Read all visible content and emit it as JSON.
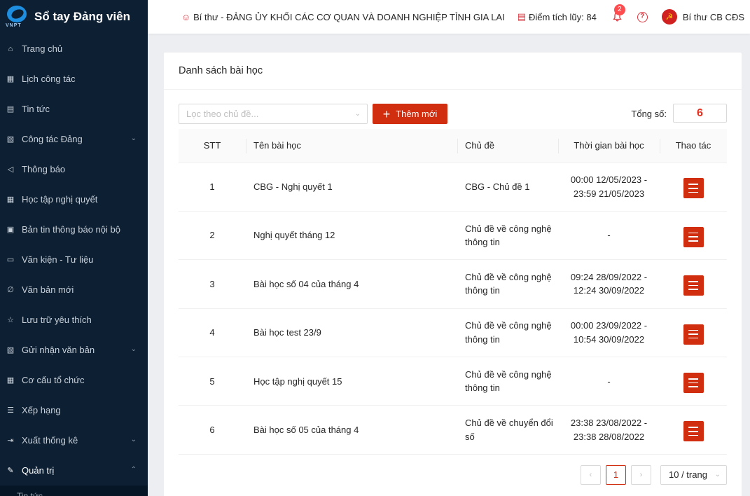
{
  "brand": {
    "title": "Sổ tay Đảng viên",
    "logo_text": "VNPT"
  },
  "sidebar": {
    "items": [
      {
        "label": "Trang chủ",
        "icon": "home-icon",
        "glyph": "⌂",
        "chevron": ""
      },
      {
        "label": "Lịch công tác",
        "icon": "calendar-icon",
        "glyph": "▦",
        "chevron": ""
      },
      {
        "label": "Tin tức",
        "icon": "news-icon",
        "glyph": "▤",
        "chevron": ""
      },
      {
        "label": "Công tác Đảng",
        "icon": "document-icon",
        "glyph": "▧",
        "chevron": "⌄"
      },
      {
        "label": "Thông báo",
        "icon": "megaphone-icon",
        "glyph": "◁",
        "chevron": ""
      },
      {
        "label": "Học tập nghị quyết",
        "icon": "grid-icon",
        "glyph": "▦",
        "chevron": ""
      },
      {
        "label": "Bản tin thông báo nội bộ",
        "icon": "bulletin-icon",
        "glyph": "▣",
        "chevron": ""
      },
      {
        "label": "Văn kiện - Tư liệu",
        "icon": "folder-icon",
        "glyph": "▭",
        "chevron": ""
      },
      {
        "label": "Văn bản mới",
        "icon": "paperclip-icon",
        "glyph": "∅",
        "chevron": ""
      },
      {
        "label": "Lưu trữ yêu thích",
        "icon": "star-icon",
        "glyph": "☆",
        "chevron": ""
      },
      {
        "label": "Gửi nhận văn bản",
        "icon": "file-exchange-icon",
        "glyph": "▧",
        "chevron": "⌄"
      },
      {
        "label": "Cơ cấu tổ chức",
        "icon": "organization-icon",
        "glyph": "▦",
        "chevron": ""
      },
      {
        "label": "Xếp hạng",
        "icon": "list-icon",
        "glyph": "☰",
        "chevron": ""
      },
      {
        "label": "Xuất thống kê",
        "icon": "export-icon",
        "glyph": "⇥",
        "chevron": "⌄"
      },
      {
        "label": "Quản trị",
        "icon": "tools-icon",
        "glyph": "✎",
        "chevron": "⌃"
      }
    ],
    "sub_item": "Tin tức"
  },
  "header": {
    "role": "Bí thư - ĐẢNG ỦY KHỐI CÁC CƠ QUAN VÀ DOANH NGHIỆP TỈNH GIA LAI",
    "points": "Điểm tích lũy: 84",
    "notification_count": "2",
    "help_glyph": "?",
    "avatar_glyph": "☭",
    "user_name": "Bí thư CB CĐS"
  },
  "page": {
    "title": "Danh sách bài học",
    "filter_placeholder": "Lọc theo chủ đề...",
    "add_label": "Thêm mới",
    "total_label": "Tổng số:",
    "total_value": "6"
  },
  "table": {
    "headers": {
      "stt": "STT",
      "name": "Tên bài học",
      "topic": "Chủ đề",
      "time": "Thời gian bài học",
      "action": "Thao tác"
    },
    "rows": [
      {
        "stt": "1",
        "name": "CBG - Nghị quyết 1",
        "topic": "CBG - Chủ đề 1",
        "time": "00:00 12/05/2023 - 23:59 21/05/2023"
      },
      {
        "stt": "2",
        "name": "Nghị quyết tháng 12",
        "topic": "Chủ đề về công nghệ thông tin",
        "time": "-"
      },
      {
        "stt": "3",
        "name": "Bài học số 04 của tháng 4",
        "topic": "Chủ đề về công nghệ thông tin",
        "time": "09:24 28/09/2022 - 12:24 30/09/2022"
      },
      {
        "stt": "4",
        "name": "Bài học test 23/9",
        "topic": "Chủ đề về công nghệ thông tin",
        "time": "00:00 23/09/2022 - 10:54 30/09/2022"
      },
      {
        "stt": "5",
        "name": "Học tập nghị quyết 15",
        "topic": "Chủ đề về công nghệ thông tin",
        "time": "-"
      },
      {
        "stt": "6",
        "name": "Bài học số 05 của tháng 4",
        "topic": "Chủ đề về chuyển đổi số",
        "time": "23:38 23/08/2022 - 23:38 28/08/2022"
      }
    ]
  },
  "pagination": {
    "prev": "‹",
    "current": "1",
    "next": "›",
    "page_size": "10 / trang"
  },
  "colors": {
    "sidebar_bg": "#0d1f33",
    "primary": "#d12d0f",
    "accent_red": "#d9363e"
  }
}
